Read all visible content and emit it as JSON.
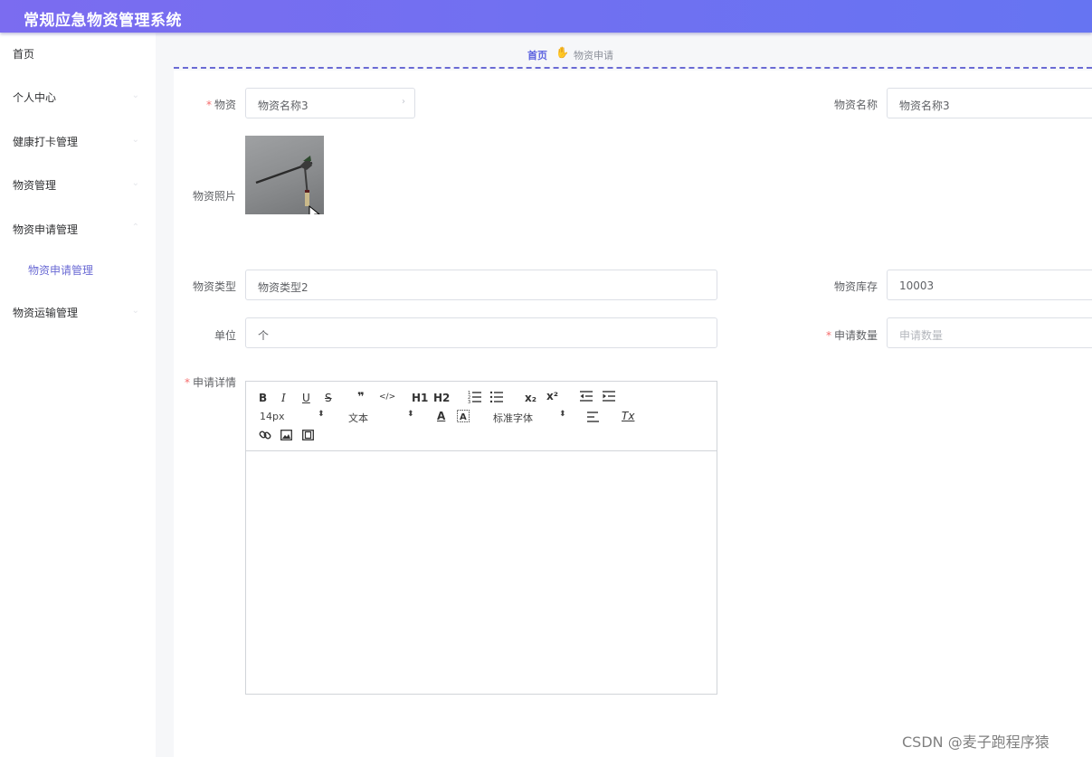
{
  "app": {
    "title": "常规应急物资管理系统"
  },
  "sidebar": {
    "items": [
      {
        "label": "首页"
      },
      {
        "label": "个人中心"
      },
      {
        "label": "健康打卡管理"
      },
      {
        "label": "物资管理"
      },
      {
        "label": "物资申请管理"
      },
      {
        "label": "物资申请管理"
      },
      {
        "label": "物资运输管理"
      }
    ]
  },
  "breadcrumb": {
    "home": "首页",
    "separator_icon": "hand-icon",
    "current": "物资申请"
  },
  "form": {
    "material": {
      "required_mark": "*",
      "label": "物资",
      "value": "物资名称3"
    },
    "material_name": {
      "label": "物资名称",
      "value": "物资名称3"
    },
    "photo": {
      "label": "物资照片"
    },
    "material_type": {
      "label": "物资类型",
      "value": "物资类型2"
    },
    "stock": {
      "label": "物资库存",
      "value": "10003"
    },
    "unit": {
      "label": "单位",
      "value": "个"
    },
    "quantity": {
      "required_mark": "*",
      "label": "申请数量",
      "placeholder": "申请数量"
    },
    "details": {
      "required_mark": "*",
      "label": "申请详情"
    }
  },
  "editor": {
    "size_select": "14px",
    "header_select": "文本",
    "font_select": "标准字体",
    "buttons": {
      "bold": "B",
      "italic": "I",
      "underline": "U",
      "strike": "S",
      "blockquote": "❞",
      "code": "</>",
      "h1": "H1",
      "h2": "H2",
      "sub": "x₂",
      "sup": "x²",
      "color": "A",
      "clean": "Tx"
    }
  },
  "watermark": "CSDN @麦子跑程序猿"
}
